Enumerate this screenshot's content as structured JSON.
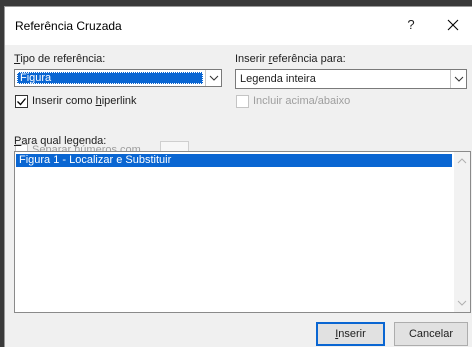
{
  "dialog": {
    "title": "Referência Cruzada",
    "help": "?"
  },
  "reference_type": {
    "label_first": "T",
    "label_rest": "ipo de referência:",
    "value": "Figura"
  },
  "insert_reference": {
    "label_pre": "Inserir ",
    "label_u": "r",
    "label_rest": "eferência para:",
    "value": "Legenda inteira"
  },
  "hyperlink": {
    "label_pre": "Inserir como ",
    "label_u": "h",
    "label_rest": "iperlink",
    "checked": true
  },
  "above_below": {
    "label": "Incluir acima/abaixo",
    "enabled": false
  },
  "separate_numbers": {
    "label": "Separar números com",
    "enabled": false
  },
  "caption_list": {
    "label_first": "P",
    "label_rest": "ara qual legenda:",
    "items": [
      "Figura 1 - Localizar e Substituir"
    ],
    "selected_index": 0
  },
  "buttons": {
    "insert_u": "I",
    "insert_rest": "nserir",
    "cancel": "Cancelar"
  },
  "colors": {
    "accent": "#0a66d2",
    "dialog_bg": "#f0f0f0"
  }
}
